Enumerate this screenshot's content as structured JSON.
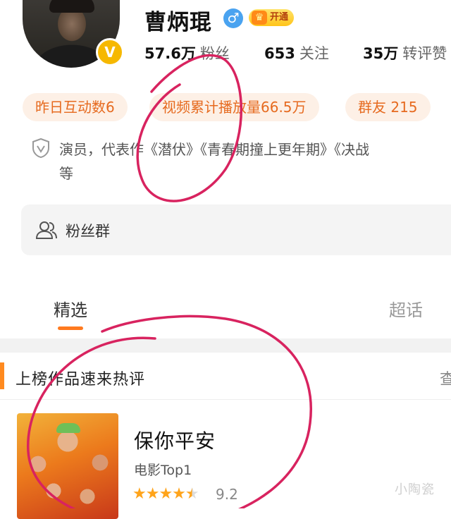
{
  "profile": {
    "name": "曹炳琨",
    "gender_icon": "male-icon",
    "gender_symbol": "♂",
    "vip_label": "开通",
    "verified_badge": "V",
    "stats": [
      {
        "value": "57.6万",
        "label": "粉丝"
      },
      {
        "value": "653",
        "label": "关注"
      },
      {
        "value": "35万",
        "label": "转评赞"
      }
    ]
  },
  "chips": [
    "昨日互动数6",
    "视频累计播放量66.5万",
    "群友 215"
  ],
  "bio": {
    "text": "演员，代表作《潜伏》《青春期撞上更年期》《决战",
    "continuation": "等"
  },
  "fans_group": {
    "label": "粉丝群"
  },
  "tabs": [
    {
      "label": "精选",
      "active": true
    },
    {
      "label": "超话",
      "active": false
    }
  ],
  "ranking_section": {
    "title": "上榜作品速来热评",
    "more": "查"
  },
  "movie": {
    "title": "保你平安",
    "rank": "电影Top1",
    "rating": "9.2",
    "stars": 4.5
  },
  "watermark": "小陶瓷",
  "colors": {
    "accent_orange": "#ff7a1f",
    "chip_bg": "#fdf0e6",
    "chip_text": "#e66a1f",
    "annotation_pen": "#d8235f",
    "star": "#ffa41b"
  }
}
